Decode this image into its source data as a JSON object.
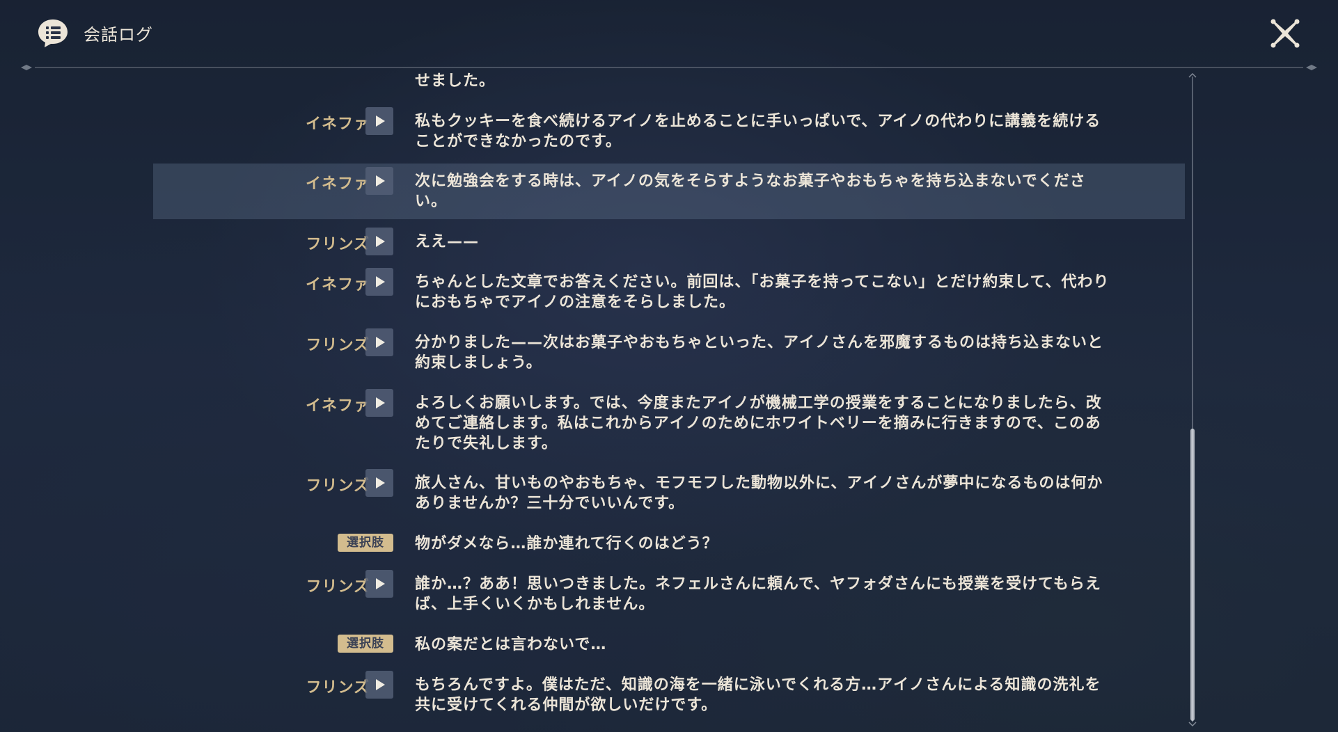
{
  "header": {
    "title": "会話ログ",
    "icon": "chat-log-icon",
    "close_icon": "close-icon"
  },
  "colors": {
    "speaker": "#d3bc8e",
    "text": "#ece5d8",
    "choice_tag_bg": "#d3bc8e",
    "highlight_row": "#5a6a86"
  },
  "log": [
    {
      "speaker": "",
      "type": "line",
      "text": "せました。"
    },
    {
      "speaker": "イネファ",
      "type": "line",
      "text": "私もクッキーを食べ続けるアイノを止めることに手いっぱいで、アイノの代わりに講義を続けることができなかったのです。"
    },
    {
      "speaker": "イネファ",
      "type": "line",
      "text": "次に勉強会をする時は、アイノの気をそらすようなお菓子やおもちゃを持ち込まないでください。",
      "highlighted": true
    },
    {
      "speaker": "フリンズ",
      "type": "line",
      "text": "ええ——"
    },
    {
      "speaker": "イネファ",
      "type": "line",
      "text": "ちゃんとした文章でお答えください。前回は、「お菓子を持ってこない」とだけ約束して、代わりにおもちゃでアイノの注意をそらしました。"
    },
    {
      "speaker": "フリンズ",
      "type": "line",
      "text": "分かりました——次はお菓子やおもちゃといった、アイノさんを邪魔するものは持ち込まないと約束しましょう。"
    },
    {
      "speaker": "イネファ",
      "type": "line",
      "text": "よろしくお願いします。では、今度またアイノが機械工学の授業をすることになりましたら、改めてご連絡します。私はこれからアイノのためにホワイトベリーを摘みに行きますので、このあたりで失礼します。"
    },
    {
      "speaker": "フリンズ",
      "type": "line",
      "text": "旅人さん、甘いものやおもちゃ、モフモフした動物以外に、アイノさんが夢中になるものは何かありませんか？三十分でいいんです。"
    },
    {
      "speaker": "選択肢",
      "type": "choice",
      "text": "物がダメなら…誰か連れて行くのはどう？"
    },
    {
      "speaker": "フリンズ",
      "type": "line",
      "text": "誰か…？ああ！思いつきました。ネフェルさんに頼んで、ヤフォダさんにも授業を受けてもらえば、上手くいくかもしれません。"
    },
    {
      "speaker": "選択肢",
      "type": "choice",
      "text": "私の案だとは言わないで…"
    },
    {
      "speaker": "フリンズ",
      "type": "line",
      "text": "もちろんですよ。僕はただ、知識の海を一緒に泳いでくれる方…アイノさんによる知識の洗礼を共に受けてくれる仲間が欲しいだけです。"
    }
  ]
}
